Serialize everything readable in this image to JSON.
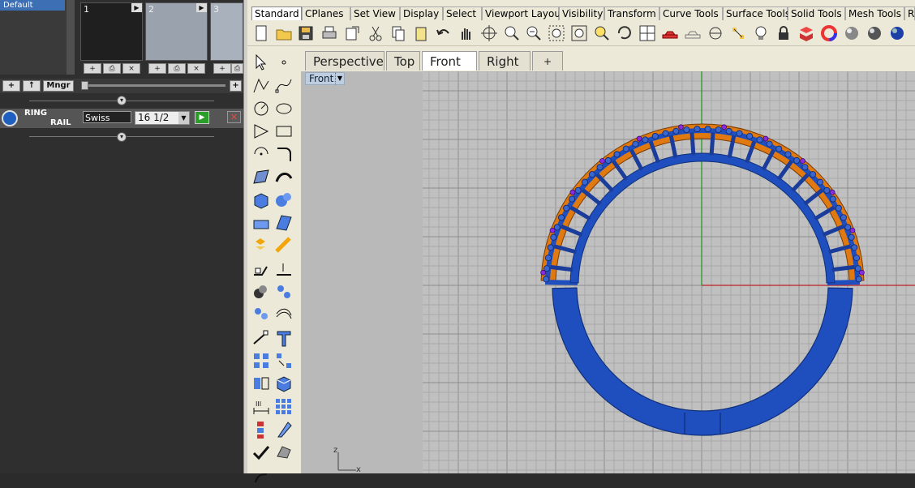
{
  "left_panel": {
    "layer_name": "Default",
    "thumbnails": [
      {
        "num": "1"
      },
      {
        "num": "2"
      },
      {
        "num": "3"
      }
    ],
    "thumb_buttons": [
      "+",
      "⎙",
      "×",
      "+",
      "⎙",
      "×",
      "+",
      "⎙"
    ],
    "bar_buttons": {
      "add": "+",
      "up": "↑",
      "manager": "Mngr",
      "right_add": "+"
    },
    "ring_tool": {
      "label_line1": "RING",
      "label_line2": "RAIL",
      "size_system": "Swiss",
      "ring_size": "16 1/2",
      "run_icon": "play-icon",
      "close_icon": "close-icon"
    }
  },
  "toolbar_tabs": [
    "Standard",
    "CPlanes",
    "Set View",
    "Display",
    "Select",
    "Viewport Layout",
    "Visibility",
    "Transform",
    "Curve Tools",
    "Surface Tools",
    "Solid Tools",
    "Mesh Tools",
    "R"
  ],
  "active_toolbar_tab": "Standard",
  "standard_icons": [
    "new-icon",
    "open-icon",
    "save-icon",
    "print-icon",
    "export-icon",
    "cut-icon",
    "copy-icon",
    "paste-icon",
    "undo-icon",
    "pan-hand-icon",
    "rotate-view-icon",
    "zoom-icon",
    "zoom-window-icon",
    "zoom-dynamic-icon",
    "zoom-extents-icon",
    "zoom-selected-icon",
    "undo-view-icon",
    "viewport-layout-icon",
    "car-icon",
    "car-wire-icon",
    "cplane-icon",
    "points-icon",
    "light-icon",
    "lock-icon",
    "layer-icon",
    "color-wheel-icon",
    "render-sphere-icon",
    "material-sphere-icon",
    "blue-sphere-icon"
  ],
  "left_tools": [
    "select-icon",
    "point-icon",
    "polyline-icon",
    "curve-icon",
    "circle-icon",
    "ellipse-icon",
    "polygon-icon",
    "rectangle-icon",
    "arc-icon",
    "fillet-icon",
    "surface-icon",
    "sweep-icon",
    "box-icon",
    "sphere-icon",
    "extrude-icon",
    "surface-patch-icon",
    "explode-icon",
    "boolean-icon",
    "trim-icon",
    "split-icon",
    "boolean-union-icon",
    "points-on-icon",
    "group-icon",
    "curve-offset-icon",
    "move-icon",
    "text-icon",
    "array-icon",
    "array-polar-icon",
    "mirror-icon",
    "solid-icon",
    "dimension-icon",
    "grid-icon",
    "align-icon",
    "scale-icon",
    "check-icon",
    "mesh-icon",
    "history-icon"
  ],
  "viewport_tabs": [
    "Perspective",
    "Top",
    "Front",
    "Right",
    "+"
  ],
  "active_viewport": "Front",
  "viewport_label": "Front",
  "axis_labels": {
    "z": "z",
    "x": "x"
  },
  "colors": {
    "ring_blue": "#1f4fbf",
    "ring_orange": "#e07a10",
    "gem_purple": "#8a2be2",
    "axis_green": "#1a9a1a",
    "axis_red": "#c02020",
    "grid": "#a8a8a8",
    "grid_major": "#8e8e8e",
    "viewport_bg": "#c0c0c0"
  }
}
